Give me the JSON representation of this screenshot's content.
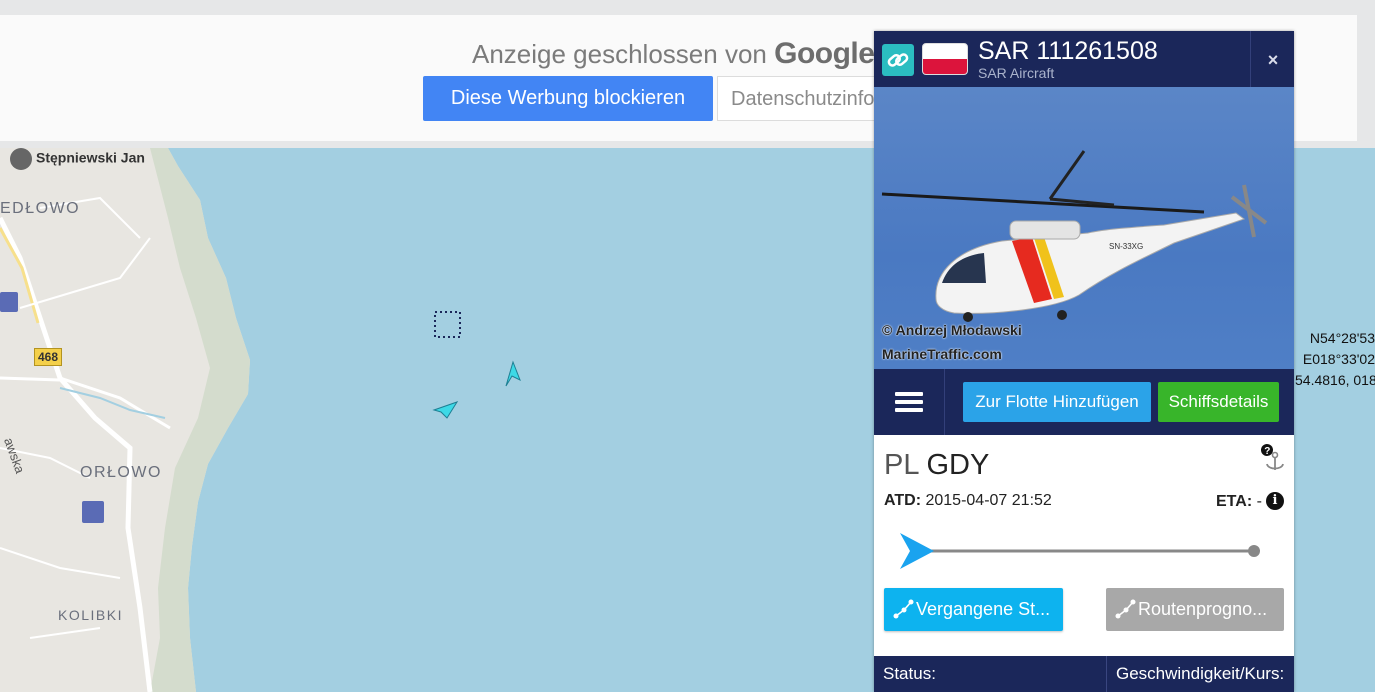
{
  "ad": {
    "closed_text": "Anzeige geschlossen von",
    "brand": "Google",
    "block_button": "Diese Werbung blockieren",
    "privacy_button": "Datenschutzinfo"
  },
  "map": {
    "labels": {
      "district_1": "EDŁOWO",
      "district_2": "ORŁOWO",
      "district_3": "KOLIBKI",
      "street": "awska",
      "road_number": "468",
      "poi": "Stępniewski Jan"
    },
    "coordinates": {
      "lat": "N54°28'53",
      "lon": "E018°33'02",
      "decimal": "54.4816, 018"
    }
  },
  "panel": {
    "title": "SAR 111261508",
    "subtitle": "SAR Aircraft",
    "flag_country": "Poland",
    "close_label": "×",
    "photo": {
      "credit_line1": "© Andrzej Młodawski",
      "credit_line2": "MarineTraffic.com",
      "registration": "SN-33XG"
    },
    "buttons": {
      "add_fleet": "Zur Flotte Hinzufügen",
      "details": "Schiffsdetails",
      "past_track": "Vergangene St...",
      "route_forecast": "Routenprogno..."
    },
    "voyage": {
      "departure_country": "PL",
      "departure_port": "GDY",
      "atd_label": "ATD:",
      "atd_value": "2015-04-07 21:52",
      "eta_label": "ETA:",
      "eta_value": "-",
      "progress": 0.0
    },
    "status_bar": {
      "status_label": "Status:",
      "speed_label": "Geschwindigkeit/Kurs:"
    }
  },
  "colors": {
    "navy": "#1b275a",
    "sea": "#a3cfe1",
    "fleet_button": "#2ba3e8",
    "details_button": "#38b52a",
    "past_track_button": "#0db3ef",
    "ad_button": "#4285f4",
    "vessel_marker": "#3dd9e6"
  }
}
